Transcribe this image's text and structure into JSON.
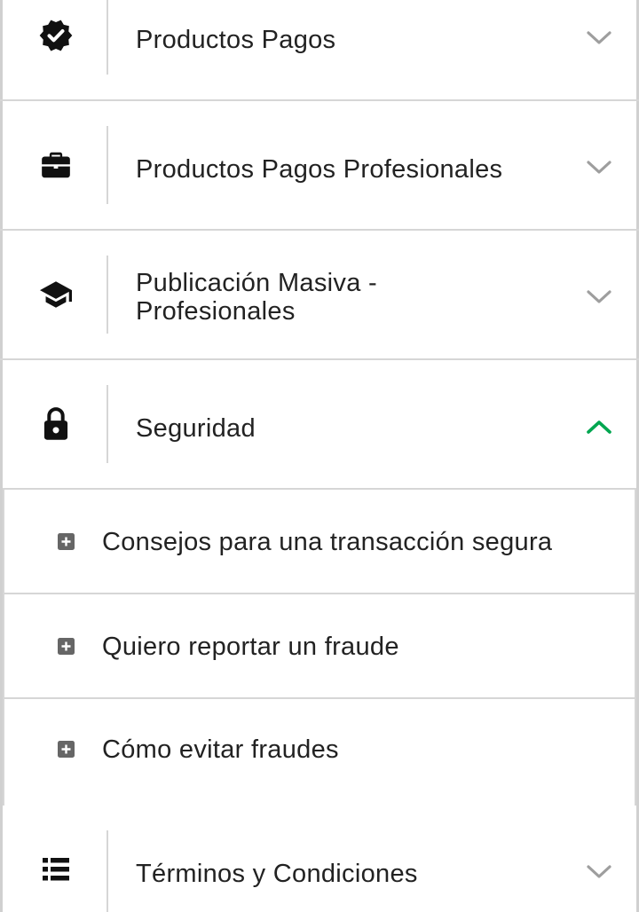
{
  "menu": {
    "sections": [
      {
        "label": "Productos Pagos",
        "icon": "verified-badge-icon",
        "expanded": false
      },
      {
        "label": "Productos Pagos Profesionales",
        "icon": "briefcase-icon",
        "expanded": false
      },
      {
        "label_line1": "Publicación Masiva -",
        "label_line2": "Profesionales",
        "icon": "graduation-cap-icon",
        "expanded": false
      },
      {
        "label": "Seguridad",
        "icon": "lock-icon",
        "expanded": true,
        "items": [
          {
            "label": "Consejos para una transacción segura"
          },
          {
            "label": "Quiero reportar un fraude"
          },
          {
            "label": "Cómo evitar fraudes"
          }
        ]
      },
      {
        "label": "Términos y Condiciones",
        "icon": "list-icon",
        "expanded": false
      }
    ]
  },
  "colors": {
    "accent": "#00a650",
    "chevron_collapsed": "#9e9e9e",
    "icon": "#111111",
    "plus_icon": "#666666",
    "divider": "#d6d6d6"
  }
}
